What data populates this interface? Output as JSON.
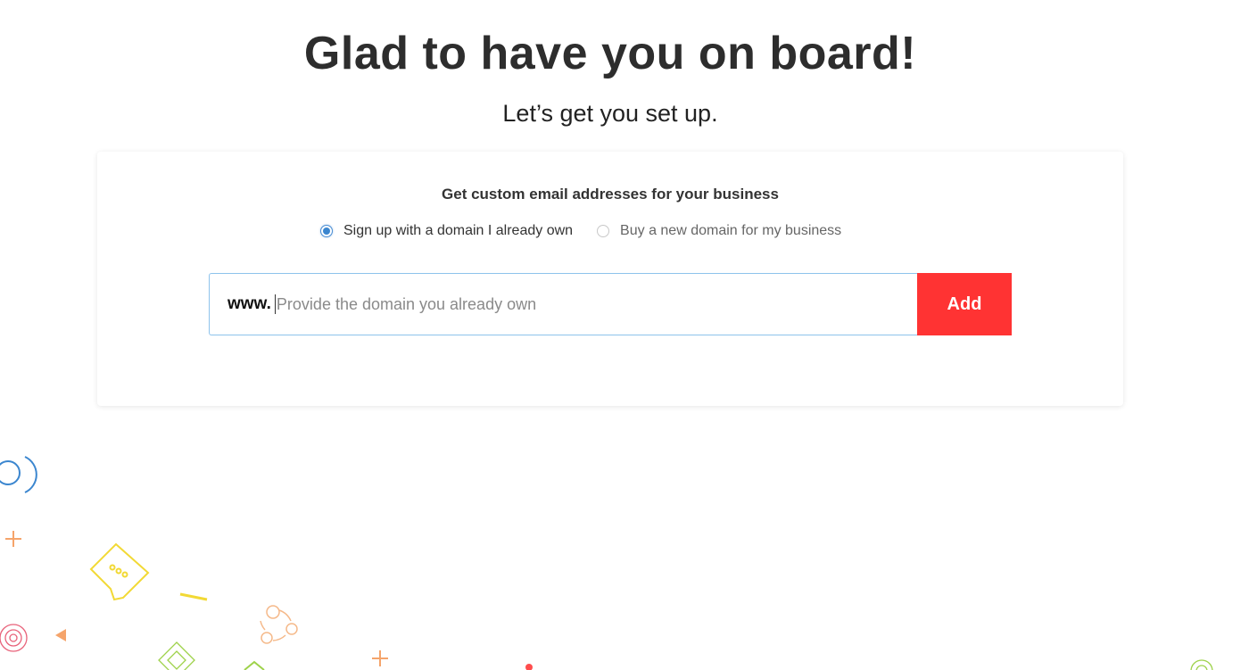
{
  "header": {
    "title": "Glad to have you on board!",
    "subtitle": "Let’s get you set up."
  },
  "card": {
    "title": "Get custom email addresses for your business",
    "options": [
      {
        "label": "Sign up with a domain I already own",
        "selected": true
      },
      {
        "label": "Buy a new domain for my business",
        "selected": false
      }
    ],
    "domain_prefix": "www.",
    "domain_placeholder": "Provide the domain you already own",
    "domain_value": "",
    "add_label": "Add"
  },
  "colors": {
    "accent": "#ff3333",
    "radio_selected": "#3b86cf",
    "input_focus_border": "#8ec3ec"
  }
}
